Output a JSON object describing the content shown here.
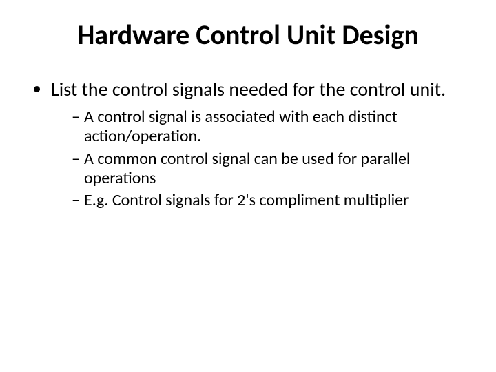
{
  "title": "Hardware Control Unit Design",
  "bullets": {
    "item1": "List the control signals needed for the control unit.",
    "sub1": "A control signal is associated with each distinct action/operation.",
    "sub2": "A common control signal can be used for parallel operations",
    "sub3": "E.g. Control signals for 2's compliment multiplier"
  }
}
